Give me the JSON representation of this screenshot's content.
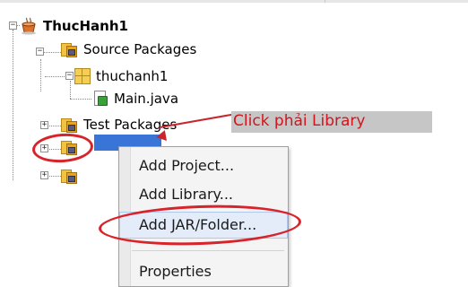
{
  "tree": {
    "project": {
      "label": "ThucHanh1"
    },
    "source_packages": {
      "label": "Source Packages"
    },
    "package": {
      "label": "thuchanh1"
    },
    "file": {
      "label": "Main.java"
    },
    "test_packages": {
      "label": "Test Packages"
    }
  },
  "annotation": {
    "text": "Click phải Library"
  },
  "context_menu": {
    "items": [
      {
        "label": "Add Project..."
      },
      {
        "label": "Add Library..."
      },
      {
        "label": "Add JAR/Folder..."
      },
      {
        "label": "Properties"
      }
    ],
    "highlighted": "Add JAR/Folder..."
  },
  "colors": {
    "annotation_red": "#d4141b",
    "selection_blue": "#3875d7",
    "menu_highlight": "#e3ecf8"
  },
  "icons": [
    "coffee-cup-icon",
    "package-folder-icon",
    "package-icon",
    "java-file-icon",
    "library-folder-icon"
  ]
}
